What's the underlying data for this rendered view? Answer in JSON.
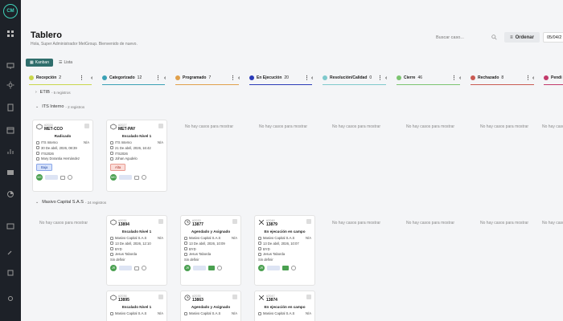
{
  "sidebar": {
    "logo_text": "CM",
    "icons": [
      "grid-icon",
      "monitor-icon",
      "box-icon",
      "sun-icon",
      "document-icon",
      "calendar-icon",
      "chart-icon",
      "store-icon",
      "pie-icon",
      "inbox-icon",
      "wrench-icon",
      "layers-icon",
      "settings-icon"
    ]
  },
  "header": {
    "title": "Tablero",
    "subtitle": "Hola, Super Administrador MetGroup. Bienvenido de nuevo.",
    "search_placeholder": "Buscar caso...",
    "sort_label": "Ordenar",
    "date": "05/04/2"
  },
  "tabs": [
    {
      "label": "Kanban"
    },
    {
      "label": "Lista"
    }
  ],
  "columns": [
    {
      "name": "Recepción",
      "count": "2",
      "color": "#c9d64b"
    },
    {
      "name": "Categorizado",
      "count": "12",
      "color": "#3aa1b5"
    },
    {
      "name": "Programado",
      "count": "7",
      "color": "#e0a04b"
    },
    {
      "name": "En Ejecución",
      "count": "20",
      "color": "#2a3bb8"
    },
    {
      "name": "Resolución/Calidad",
      "count": "0",
      "color": "#7ec9cc"
    },
    {
      "name": "Cierre",
      "count": "46",
      "color": "#7cc470"
    },
    {
      "name": "Rechazado",
      "count": "8",
      "color": "#c95a52"
    },
    {
      "name": "Pendi",
      "count": "",
      "color": "#c23a6a"
    }
  ],
  "groups": [
    {
      "name": "ETIB",
      "sub": "- 5 registros"
    },
    {
      "name": "ITS Interno",
      "sub": "- 2 registros"
    },
    {
      "name": "Masivo Capital S.A.S",
      "sub": "- 24 registros"
    }
  ],
  "empty_text": "No hay casos para mostrar",
  "cards": [
    {
      "num": "#2024",
      "code": "MET-CCO",
      "title": "Radicado",
      "client": "ITS Interno",
      "na": "N/A",
      "date": "30 De abril, 2026, 08:39",
      "ref": "ITS2026",
      "person": "Mary Dorantia Hernández",
      "badge": "Baja",
      "avatar": "MS"
    },
    {
      "num": "#2027",
      "code": "MET-PAY",
      "title": "Escalado Nivel 1",
      "client": "ITS Interno",
      "na": "N/A",
      "date": "21 De abril, 2026, 16:42",
      "ref": "ITS2026",
      "person": "Johan Agudelo",
      "badge": "Alta",
      "avatar": "MG"
    },
    {
      "num": "#2031",
      "code": "13894",
      "title": "Escalado Nivel 1",
      "client": "Masivo Capital S.A.S",
      "na": "N/A",
      "date": "13 De abril, 2026, 12:10",
      "ref": "BYD",
      "person": "Jesus Taborda",
      "extra": "Sin definir",
      "avatar": "JR"
    },
    {
      "num": "#2033",
      "code": "13877",
      "title": "Agendado y Asignado",
      "client": "Masivo Capital S.A.S",
      "na": "N/A",
      "date": "13 De abril, 2026, 10:09",
      "ref": "BYD",
      "person": "Jesus Taborda",
      "extra": "Sin definir",
      "avatar": "JR"
    },
    {
      "num": "#2046",
      "code": "13879",
      "title": "En ejecución en campo",
      "client": "Masivo Capital S.A.S",
      "na": "N/A",
      "date": "13 De abril, 2026, 10:07",
      "ref": "BYD",
      "person": "Jesus Taborda",
      "extra": "Sin definir",
      "avatar": "JR"
    },
    {
      "num": "#2036",
      "code": "13895",
      "title": "Escalado Nivel 1",
      "client": "Masivo Capital S.A.S",
      "na": "N/A"
    },
    {
      "num": "#2035",
      "code": "13863",
      "title": "Agendado y Asignado",
      "client": "Masivo Capital S.A.S",
      "na": "N/A"
    },
    {
      "num": "#2047",
      "code": "13874",
      "title": "En ejecución en campo",
      "client": "Masivo Capital S.A.S",
      "na": "N/A"
    }
  ]
}
